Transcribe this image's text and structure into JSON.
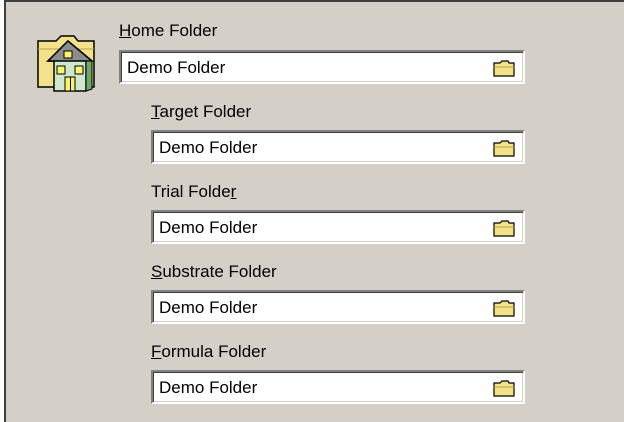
{
  "fields": [
    {
      "label_before": "",
      "label_ul": "H",
      "label_after": "ome Folder",
      "value": "Demo Folder"
    },
    {
      "label_before": "",
      "label_ul": "T",
      "label_after": "arget Folder",
      "value": "Demo Folder"
    },
    {
      "label_before": "Trial Folde",
      "label_ul": "r",
      "label_after": "",
      "value": "Demo Folder"
    },
    {
      "label_before": "",
      "label_ul": "S",
      "label_after": "ubstrate Folder",
      "value": "Demo Folder"
    },
    {
      "label_before": "",
      "label_ul": "F",
      "label_after": "ormula Folder",
      "value": "Demo Folder"
    }
  ],
  "icons": {
    "home": "home-folder-icon",
    "browse": "browse-folder-icon"
  },
  "colors": {
    "panel_bg": "#d4d0c8",
    "folder_yellow": "#f4e28a"
  }
}
